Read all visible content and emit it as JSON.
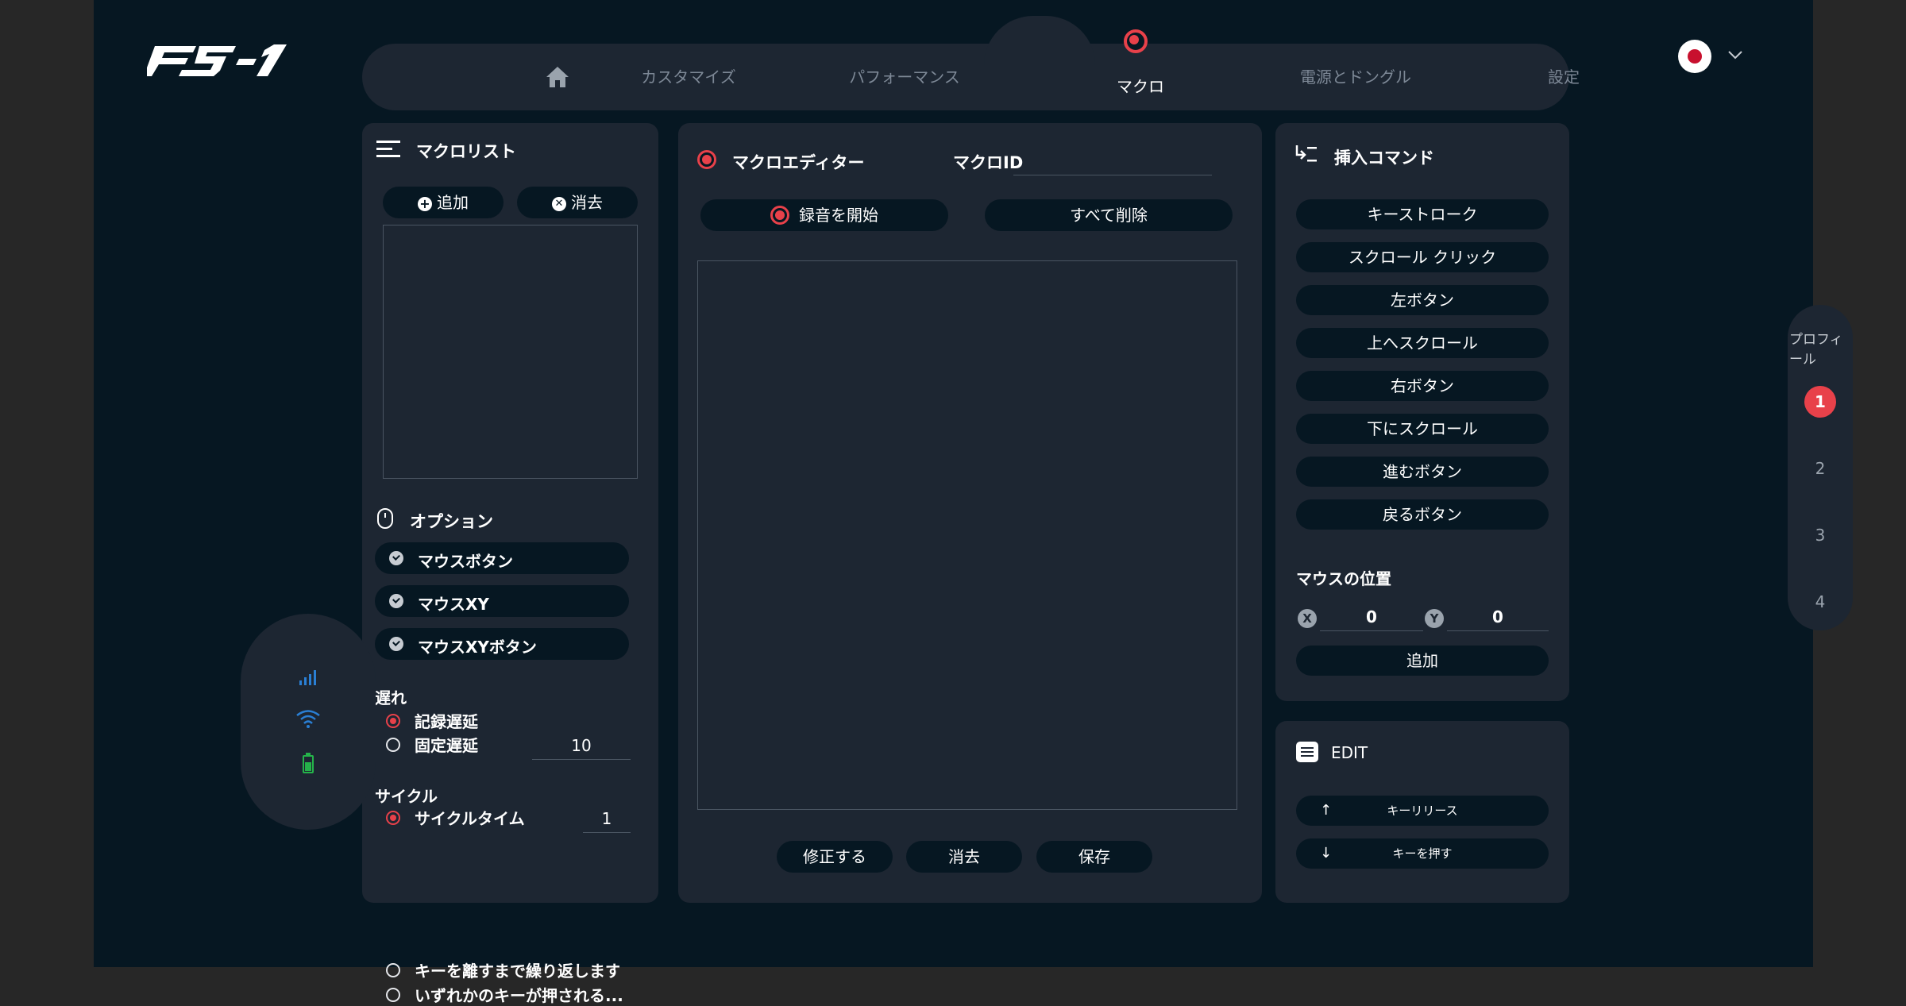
{
  "nav": {
    "home_label": "home",
    "items": [
      "カスタマイズ",
      "パフォーマンス",
      "マクロ",
      "電源とドングル",
      "設定"
    ],
    "active": "マクロ"
  },
  "macro_list": {
    "title": "マクロリスト",
    "add_button": "追加",
    "delete_button": "消去"
  },
  "options": {
    "title": "オプション",
    "items": [
      "マウスボタン",
      "マウスXY",
      "マウスXYボタン"
    ],
    "delay": {
      "title": "遅れ",
      "record_delay": "記録遅延",
      "fixed_delay": "固定遅延",
      "fixed_delay_value": "10"
    },
    "cycle": {
      "title": "サイクル",
      "cycle_time": "サイクルタイム",
      "cycle_time_value": "1",
      "repeat_until_release": "キーを離すまで繰り返します",
      "until_any_key": "いずれかのキーが押される..."
    }
  },
  "editor": {
    "title": "マクロエディター",
    "macro_id_label": "マクロID",
    "macro_id_value": "",
    "record_button": "録音を開始",
    "delete_all_button": "すべて削除",
    "modify_button": "修正する",
    "erase_button": "消去",
    "save_button": "保存"
  },
  "insert": {
    "title": "挿入コマンド",
    "commands": [
      "キーストローク",
      "スクロール クリック",
      "左ボタン",
      "上へスクロール",
      "右ボタン",
      "下にスクロール",
      "進むボタン",
      "戻るボタン"
    ],
    "mouse_position_title": "マウスの位置",
    "x_label": "X",
    "x_value": "0",
    "y_label": "Y",
    "y_value": "0",
    "add_button": "追加"
  },
  "edit": {
    "title": "EDIT",
    "key_release": "キーリリース",
    "key_press": "キーを押す"
  },
  "profile": {
    "title": "プロフィール",
    "items": [
      "1",
      "2",
      "3",
      "4"
    ],
    "active": "1"
  },
  "colors": {
    "background": "#061722",
    "panel": "#1d2632",
    "accent_red": "#e8414a",
    "signal_blue": "#2a7fd4",
    "battery_green": "#25b34a"
  }
}
